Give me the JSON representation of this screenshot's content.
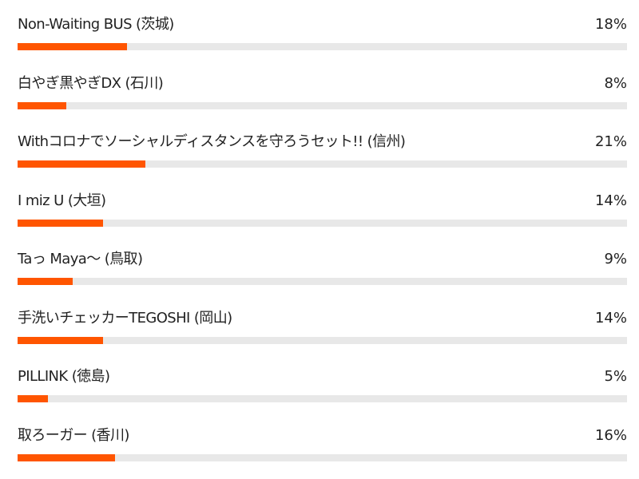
{
  "chart_data": {
    "type": "bar",
    "orientation": "horizontal",
    "unit": "%",
    "xlim": [
      0,
      100
    ],
    "categories": [
      "Non-Waiting BUS (茨城)",
      "白やぎ黒やぎDX (石川)",
      "Withコロナでソーシャルディスタンスを守ろうセット!! (信州)",
      "I miz U (大垣)",
      "Taっ Maya〜 (鳥取)",
      "手洗いチェッカーTEGOSHI (岡山)",
      "PILLINK (徳島)",
      "取ろーガー (香川)"
    ],
    "values": [
      18,
      8,
      21,
      14,
      9,
      14,
      5,
      16
    ],
    "value_labels": [
      "18%",
      "8%",
      "21%",
      "14%",
      "9%",
      "14%",
      "5%",
      "16%"
    ],
    "colors": {
      "fill": "#ff5500",
      "track": "#e8e8e8"
    }
  }
}
